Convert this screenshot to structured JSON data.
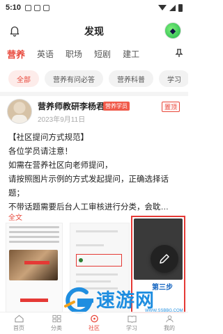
{
  "status_bar": {
    "time": "5:10"
  },
  "header": {
    "title": "发现"
  },
  "category_tabs": [
    "营养",
    "英语",
    "职场",
    "短剧",
    "建工"
  ],
  "filter_chips": [
    "全部",
    "营养有问必答",
    "营养科普",
    "学习"
  ],
  "post": {
    "author": "营养师教研李杨君",
    "badge": "营养学员",
    "date": "2023年9月11日",
    "pin_label": "置顶",
    "lines": [
      "【社区提问方式规范】",
      "各位学员请注意！",
      "如需在营养社区向老师提问，",
      "请按照图片示例的方式发起提问，正确选择话",
      "题；",
      "不带话题需要后台人工审核进行分类，会耽…"
    ],
    "more_label": "全文",
    "image_step_label": "第三步"
  },
  "watermark": {
    "text": "速游网",
    "url": "WWW.SSBBG.COM"
  },
  "bottom_nav": [
    {
      "label": "首页",
      "icon": "home-icon"
    },
    {
      "label": "分类",
      "icon": "category-icon"
    },
    {
      "label": "社区",
      "icon": "community-icon",
      "active": true
    },
    {
      "label": "学习",
      "icon": "study-icon"
    },
    {
      "label": "我的",
      "icon": "profile-icon"
    }
  ],
  "colors": {
    "accent": "#e8483b",
    "watermark_blue": "#1f8ee0"
  }
}
